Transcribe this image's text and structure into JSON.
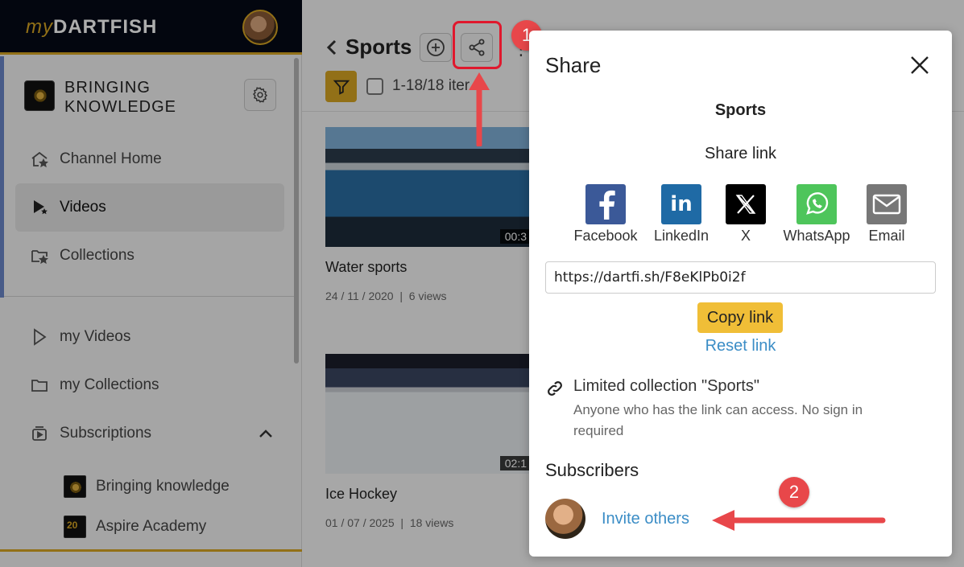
{
  "app": {
    "logo_prefix": "my",
    "logo_name": "DARTFISH"
  },
  "channel": {
    "name_line1": "BRINGING",
    "name_line2": "KNOWLEDGE"
  },
  "nav": [
    {
      "label": "Channel Home",
      "icon": "home-star-icon"
    },
    {
      "label": "Videos",
      "icon": "play-star-icon",
      "active": true
    },
    {
      "label": "Collections",
      "icon": "folder-star-icon"
    }
  ],
  "my_nav": [
    {
      "label": "my Videos",
      "icon": "play-outline-icon"
    },
    {
      "label": "my Collections",
      "icon": "folder-outline-icon"
    },
    {
      "label": "Subscriptions",
      "icon": "subscriptions-icon"
    }
  ],
  "subscriptions": [
    {
      "label": "Bringing knowledge"
    },
    {
      "label": "Aspire Academy",
      "badge": "20"
    }
  ],
  "main": {
    "title": "Sports",
    "items_count": "1-18/18 iter"
  },
  "videos": [
    {
      "title": "Water sports",
      "date": "24 / 11 / 2020",
      "separator": "|",
      "views": "6 views",
      "duration": "00:3"
    },
    {
      "title": "Ice Hockey",
      "date": "01 / 07 / 2025",
      "separator": "|",
      "views": "18 views",
      "duration": "02:1"
    }
  ],
  "annotations": {
    "step1": "1",
    "step2": "2"
  },
  "share_modal": {
    "title": "Share",
    "collection": "Sports",
    "share_link_label": "Share link",
    "socials": [
      {
        "label": "Facebook",
        "color": "#3b5998"
      },
      {
        "label": "LinkedIn",
        "color": "#1f6aa5"
      },
      {
        "label": "X",
        "color": "#000000"
      },
      {
        "label": "WhatsApp",
        "color": "#4ec55b"
      },
      {
        "label": "Email",
        "color": "#777777"
      }
    ],
    "link": "https://dartfi.sh/F8eKlPb0i2f",
    "copy_label": "Copy link",
    "reset_label": "Reset link",
    "limited_title": "Limited collection \"Sports\"",
    "limited_desc": "Anyone who has the link can access. No sign in required",
    "subscribers_heading": "Subscribers",
    "invite_label": "Invite others"
  },
  "colors": {
    "accent": "#d8a622",
    "annotation": "#e8474a",
    "link": "#3b8dc6"
  }
}
